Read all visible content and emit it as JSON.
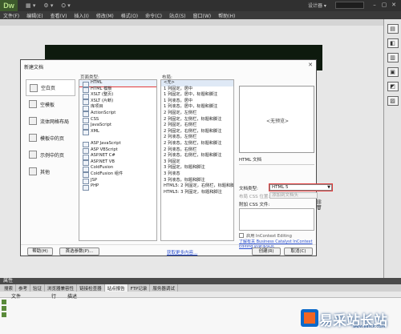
{
  "app": {
    "logo": "Dw",
    "workspace_label": "设计器 ▾",
    "menu": [
      "文件(F)",
      "编辑(E)",
      "查看(V)",
      "插入(I)",
      "修改(M)",
      "格式(O)",
      "命令(C)",
      "站点(S)",
      "窗口(W)",
      "帮助(H)"
    ]
  },
  "dialog": {
    "title": "新建文档",
    "categories": [
      "空白页",
      "空模板",
      "流体网格布局",
      "模板中的页",
      "示例中的页",
      "其他"
    ],
    "page_type_header": "页面类型:",
    "page_types": [
      "HTML",
      "HTML 模板",
      "XSLT (整页)",
      "XSLT (片断)",
      "库项目",
      "ActionScript",
      "CSS",
      "JavaScript",
      "XML",
      "",
      "ASP JavaScript",
      "ASP VBScript",
      "ASP.NET C#",
      "ASP.NET VB",
      "ColdFusion",
      "ColdFusion 组件",
      "JSP",
      "PHP"
    ],
    "layout_header": "布局:",
    "layouts": [
      "<无>",
      "1 列固定，居中",
      "1 列固定，居中，标题和脚注",
      "1 列液态，居中",
      "1 列液态，居中，标题和脚注",
      "2 列固定，左侧栏",
      "2 列固定，左侧栏，标题和脚注",
      "2 列固定，右侧栏",
      "2 列固定，右侧栏，标题和脚注",
      "2 列液态，左侧栏",
      "2 列液态，左侧栏，标题和脚注",
      "2 列液态，右侧栏",
      "2 列液态，右侧栏，标题和脚注",
      "3 列固定",
      "3 列固定，标题和脚注",
      "3 列液态",
      "3 列液态，标题和脚注",
      "HTML5: 2 列固定，右侧栏，标题和脚注",
      "HTML5: 3 列固定，标题和脚注"
    ],
    "preview_text": "<无预览>",
    "doc_desc": "HTML 文档",
    "doctype_label": "文档类型:",
    "doctype_value": "HTML 5",
    "css_position_label": "布局 CSS 位置:",
    "css_position_value": "添加到文档头",
    "attach_css_label": "附加 CSS 文件:",
    "css_tools": "⛓ 🗑",
    "incontext_label": "启用 InContext Editing",
    "learn_link": "了解有关 Business Catalyst InContext Editing 的更多信息",
    "buttons": {
      "help": "帮助(H)",
      "prefs": "首选参数(P)...",
      "more": "获取更多内容...",
      "create": "创建(R)",
      "cancel": "取消(C)"
    },
    "close_glyph": "✕"
  },
  "panels": {
    "properties_label": "属性",
    "bottom_tabs": [
      "搜索",
      "参考",
      "验证",
      "浏览器兼容性",
      "链接检查器",
      "站点报告",
      "FTP记录",
      "服务器调试"
    ],
    "active_tab_index": 5,
    "columns": [
      "文件",
      "行",
      "描述"
    ]
  },
  "watermark": {
    "text": "易采站长站",
    "url": "www.easck.com"
  },
  "colors": {
    "accent_green": "#3d5a2c",
    "highlight_red": "#e23b3b",
    "link_blue": "#2a4fd0"
  }
}
